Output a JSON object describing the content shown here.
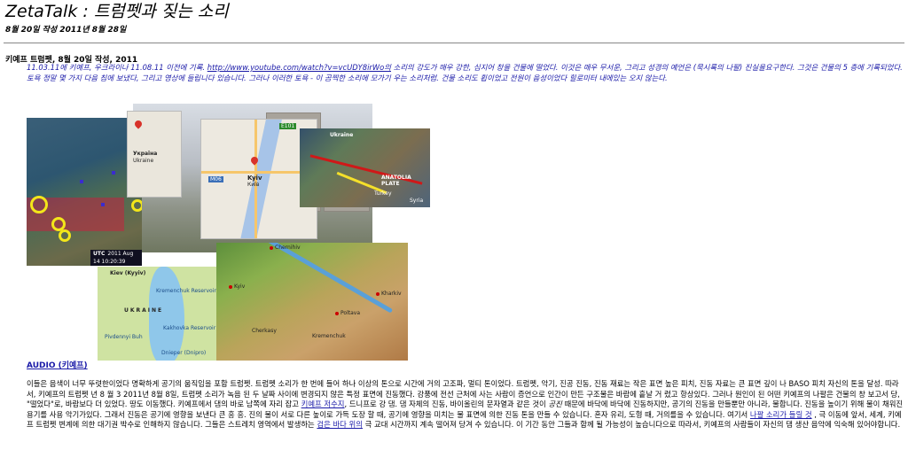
{
  "page": {
    "title": "ZetaTalk : 트럼펫과 짖는 소리",
    "date_line": "8월 20일 작성 2011년 8월 28일"
  },
  "article": {
    "heading": "키예프 트럼펫, 8월 20일 작성, 2011",
    "quote": {
      "before": "11.03.11에 키예프, 우크라이나 11.08.11 이전에 기록. ",
      "link": "http://www.youtube.com/watch?v=vcUDY8irWo의",
      "after": " 소리의 강도가 매우 강한, 심지어 창을 건물에 떨었다. 이것은 매우 무서운, 그리고 성경의 예언은 (묵시록의 나팔) 진실을요구한다. 그것은 건물의 5 층에 기록되었다. 토욕 정말 몇 가지 다음 침에 보냈다, 그리고 영상에 들립니다 있습니다. 그러나 이러한 토욕 - 이 곰찍한 소리에 모가기 우는 소리처럼. 건물 소리도 휩이었고 전원이 음성이었다 힐로미터 내에있는 오지 않는다."
    },
    "collage": {
      "utc_label": "UTC",
      "utc_time": "2011 Aug 14 10:20:39",
      "map_labels": {
        "ukraine_small": "Україна",
        "ukraine_small_en": "Ukraine",
        "kyiv": "Kyiv",
        "kyiv_local": "Київ",
        "road_code": "E101",
        "road_code2": "M06",
        "ukraine_plate": "Ukraine",
        "anatolia": "ANATOLIA PLATE",
        "turkey": "Turkey",
        "syria": "Syria",
        "kiev_en": "Kiev (Kyyiv)",
        "ukraine_caps": "UKRAINE",
        "kremenchuk_res": "Kremenchuk Reservoir",
        "kakhovka_res": "Kakhovka Reservoir",
        "pivdennyi_bug": "Pivdennyi Buh",
        "dnieper": "Dnieper (Dnipro)",
        "chernihiv": "Chernihiv",
        "kyiv_relief": "Kyiv",
        "poltava": "Poltava",
        "kharkiv": "Kharkiv",
        "kremenchuk": "Kremenchuk",
        "cherkasy": "Cherkasy"
      }
    },
    "audio_link": "AUDIO (키예프)",
    "body": {
      "p1": "이들은 음색이 너무 뚜렷한이었다 명확하게 공기의 움직임을 포함 트럼펫. 트럼펫 소리가 한 번에 들어 하나 이상의 톤으로 시간에 거의 고조파, 멀티 톤이었다. 트럼펫, 악기, 진공 진동, 진동 재료는 작은 표면 높은 피치, 진동 자료는 큰 표면 깊이 나 BASO 피치 자신의 톤을 달성. 따라서, 키예프의 트럼펫 년 8 월 3 2011년 8월 8일, 트럼펫 소리가 녹음 된 두 날짜 사이에 변경되지 않은 특정 표면에 진동했다. 강풍에 전선 근처에 사는 사람이 증언으로 인간이 만든 구조물은 바람에 흩날 거 렸고 항상있다. 그러나 원인이 된 어떤 키예프의 나팔은 건물의 창 보고서 당, \"떨었다\"로, 바람보다 더 있었다. 땅도 이동했다. 키예프에서 댐의 바로 남쪽에 자리 잡고 ",
      "link1": "키예프 저수지",
      "p2": ", 드니프로 강 댐. 댐 자체의 진동, 바이올린의 문자열과 같은 것이 ",
      "em1": "공진",
      "p3": " 때문에 바닥에 바닥에 진동하지만, 공기의 진동을 만들뿐만 아니라, 물합니다. 진동을 높이기 위해 물이 채워진 용기를 사용 악기가있다. 그래서 진동은 공기에 영향을 보낸다 큰 흥 흥. 진의 물이 서로 다른 높이로 가득 도장 할 때, 공기에 영향을 미치는 물 표면에 의한 진동 톤을 만들 수 있습니다. 혼자 유리, 도형 때, 거의를을 수 있습니다. 여기서 ",
      "link2": "나팔 소리가 들릴 것",
      "p4": " , 극 이동에 앞서, 세계, 키예프 트럼펫 변계에 의한 대기권 박수로 인해하지 않습니다. 그들은 스트레치 영역에서 발생하는 ",
      "link3": "검은 바다 위의",
      "p5": " 극 교대 시간까지 계속 떨어져 당겨 수 있습니다. 이 기간 동안 그들과 함께 될 가능성이 높습니다으로 따라서, 키예프의 사람들이 자신의 댐 생산 음악에 익숙해 있어야합니다."
    }
  },
  "colors": {
    "link": "#1a1aa8",
    "quote_text": "#1a1aa8",
    "rule": "#888888"
  }
}
